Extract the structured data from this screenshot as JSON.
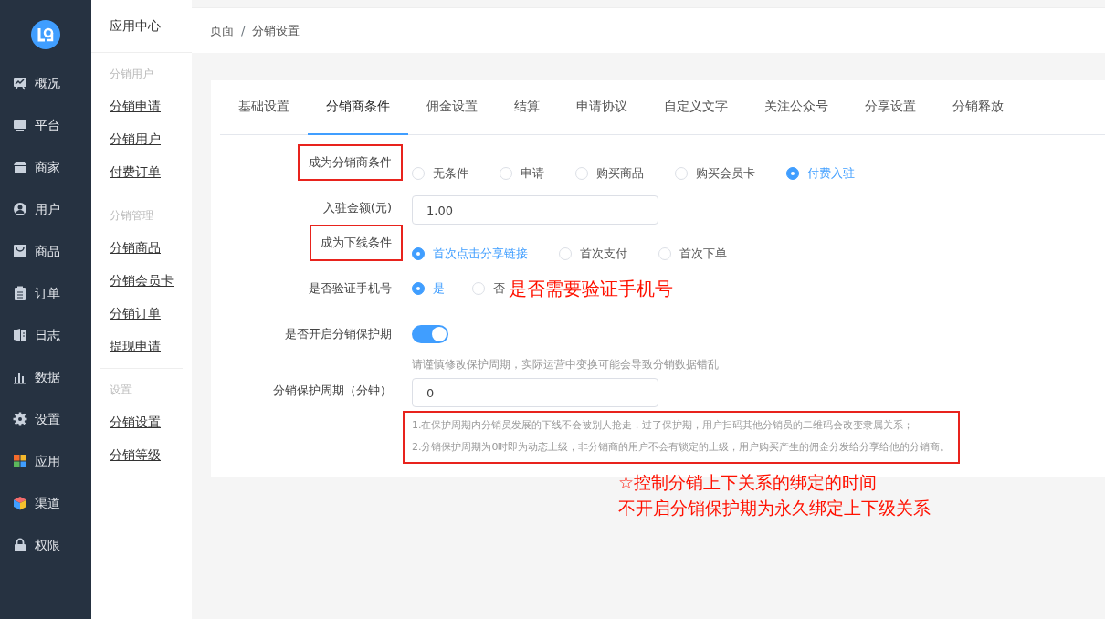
{
  "sidebar": {
    "items": [
      {
        "label": "概况",
        "selected": false
      },
      {
        "label": "平台",
        "selected": false
      },
      {
        "label": "商家",
        "selected": false
      },
      {
        "label": "用户",
        "selected": false
      },
      {
        "label": "商品",
        "selected": false
      },
      {
        "label": "订单",
        "selected": false
      },
      {
        "label": "日志",
        "selected": false
      },
      {
        "label": "数据",
        "selected": false
      },
      {
        "label": "设置",
        "selected": false
      },
      {
        "label": "应用",
        "selected": false
      },
      {
        "label": "渠道",
        "selected": false
      },
      {
        "label": "权限",
        "selected": false
      }
    ]
  },
  "submenu": {
    "title": "应用中心",
    "groups": [
      {
        "heading": "分销用户",
        "items": [
          "分销申请",
          "分销用户",
          "付费订单"
        ]
      },
      {
        "heading": "分销管理",
        "items": [
          "分销商品",
          "分销会员卡",
          "分销订单",
          "提现申请"
        ]
      },
      {
        "heading": "设置",
        "items": [
          "分销设置",
          "分销等级"
        ]
      }
    ]
  },
  "breadcrumb": {
    "items": [
      "页面",
      "分销设置"
    ],
    "separator": "/"
  },
  "tabs": [
    {
      "label": "基础设置",
      "selected": false
    },
    {
      "label": "分销商条件",
      "selected": true
    },
    {
      "label": "佣金设置",
      "selected": false
    },
    {
      "label": "结算",
      "selected": false
    },
    {
      "label": "申请协议",
      "selected": false
    },
    {
      "label": "自定义文字",
      "selected": false
    },
    {
      "label": "关注公众号",
      "selected": false
    },
    {
      "label": "分享设置",
      "selected": false
    },
    {
      "label": "分销释放",
      "selected": false
    }
  ],
  "form": {
    "rows": [
      {
        "kind": "radio",
        "label": "成为分销商条件",
        "highlighted": true,
        "options": [
          {
            "label": "无条件",
            "selected": false
          },
          {
            "label": "申请",
            "selected": false
          },
          {
            "label": "购买商品",
            "selected": false
          },
          {
            "label": "购买会员卡",
            "selected": false
          },
          {
            "label": "付费入驻",
            "selected": true
          }
        ]
      },
      {
        "kind": "input",
        "label": "入驻金额(元)",
        "highlighted": false,
        "value": "1.00"
      },
      {
        "kind": "radio",
        "label": "成为下线条件",
        "highlighted": true,
        "options": [
          {
            "label": "首次点击分享链接",
            "selected": true
          },
          {
            "label": "首次支付",
            "selected": false
          },
          {
            "label": "首次下单",
            "selected": false
          }
        ]
      },
      {
        "kind": "radio",
        "label": "是否验证手机号",
        "highlighted": false,
        "options": [
          {
            "label": "是",
            "selected": true
          },
          {
            "label": "否",
            "selected": false
          }
        ],
        "annotation": "是否需要验证手机号"
      },
      {
        "kind": "switch",
        "label": "是否开启分销保护期",
        "highlighted": false,
        "on": true,
        "hint": "请谨慎修改保护周期，实际运营中变换可能会导致分销数据错乱"
      },
      {
        "kind": "input",
        "label": "分销保护周期（分钟）",
        "highlighted": false,
        "value": "0",
        "notes_highlighted": true,
        "notes": [
          "1.在保护周期内分销员发展的下线不会被别人抢走，过了保护期，用户扫码其他分销员的二维码会改变隶属关系；",
          "2.分销保护周期为0时即为动态上级，非分销商的用户不会有锁定的上级，用户购买产生的佣金分发给分享给他的分销商。"
        ]
      }
    ]
  },
  "annotation": [
    "☆控制分销上下关系的绑定的时间",
    "不开启分销保护期为永久绑定上下级关系"
  ]
}
